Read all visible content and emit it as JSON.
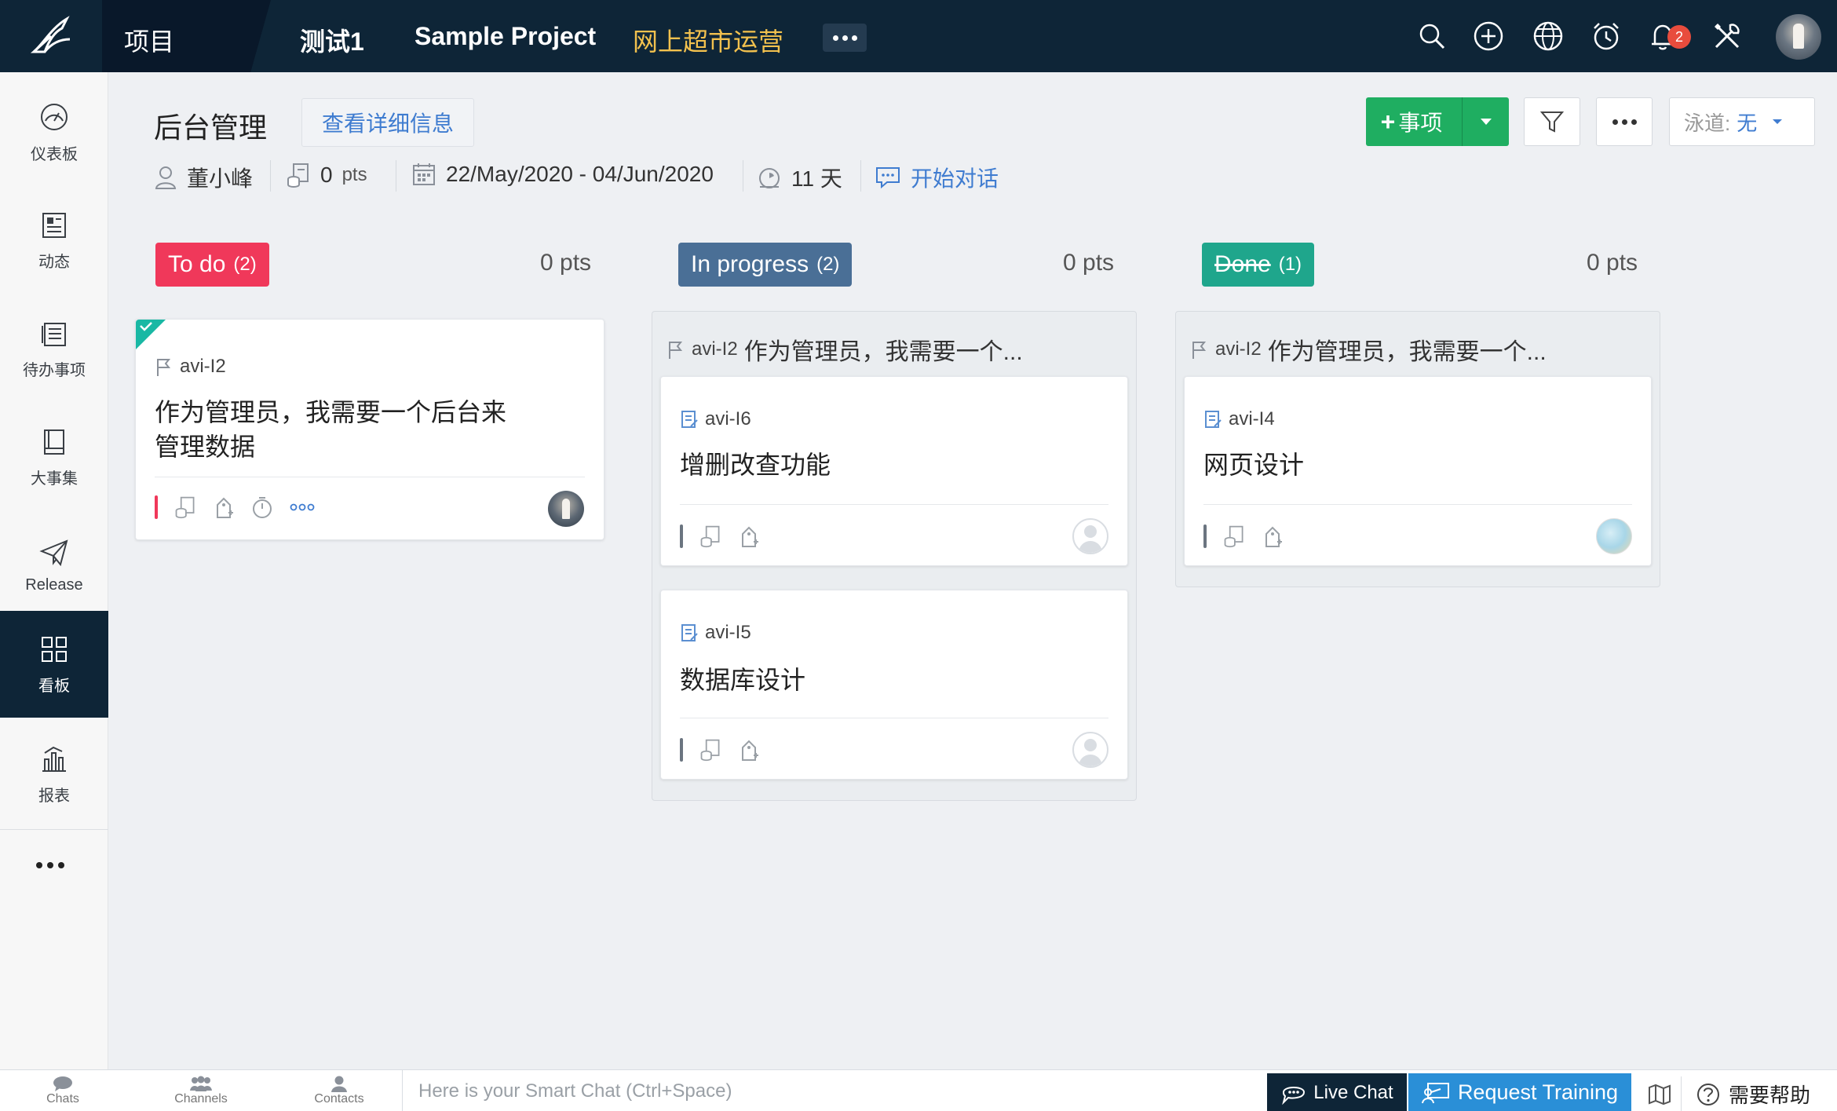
{
  "topbar": {
    "nav_label": "项目",
    "crumbs": [
      "测试1",
      "Sample Project",
      "网上超市运营"
    ],
    "notification_count": "2",
    "icons": [
      "search-icon",
      "add-circle-icon",
      "globe-icon",
      "alarm-clock-icon",
      "bell-icon",
      "tools-icon"
    ]
  },
  "sidebar": {
    "items": [
      {
        "label": "仪表板",
        "icon": "dashboard-icon"
      },
      {
        "label": "动态",
        "icon": "feed-icon"
      },
      {
        "label": "待办事项",
        "icon": "backlog-icon"
      },
      {
        "label": "大事集",
        "icon": "epic-icon"
      },
      {
        "label": "Release",
        "icon": "paper-plane-icon"
      },
      {
        "label": "看板",
        "icon": "board-icon"
      },
      {
        "label": "报表",
        "icon": "report-icon"
      }
    ],
    "active": "看板"
  },
  "header": {
    "title": "后台管理",
    "detail_button": "查看详细信息",
    "owner": "董小峰",
    "points_value": "0",
    "points_unit": "pts",
    "date_range": "22/May/2020 - 04/Jun/2020",
    "duration": "11 天",
    "chat_link": "开始对话",
    "add_button": "事项",
    "swimlane_key": "泳道:",
    "swimlane_value": "无"
  },
  "board": {
    "columns": [
      {
        "name": "To do",
        "count": "(2)",
        "points": "0 pts",
        "color": "#f0385a",
        "cards": [
          {
            "id": "avi-I2",
            "title_lines": [
              "作为管理员，我需要一个后台来",
              "管理数据"
            ],
            "priority_color": "#f0385a"
          }
        ]
      },
      {
        "name": "In progress",
        "count": "(2)",
        "points": "0 pts",
        "color": "#4a6f96",
        "parent": {
          "id": "avi-I2",
          "title": "作为管理员，我需要一个..."
        },
        "cards": [
          {
            "id": "avi-I6",
            "title": "增删改查功能",
            "priority_color": "#6b7580"
          },
          {
            "id": "avi-I5",
            "title": "数据库设计",
            "priority_color": "#6b7580"
          }
        ]
      },
      {
        "name": "Done",
        "count": "(1)",
        "points": "0 pts",
        "color": "#1fa68c",
        "parent": {
          "id": "avi-I2",
          "title": "作为管理员，我需要一个..."
        },
        "cards": [
          {
            "id": "avi-I4",
            "title": "网页设计",
            "priority_color": "#6b7580"
          }
        ]
      }
    ]
  },
  "bottombar": {
    "tabs": [
      "Chats",
      "Channels",
      "Contacts"
    ],
    "chat_placeholder": "Here is your Smart Chat (Ctrl+Space)",
    "live_chat": "Live Chat",
    "request_training": "Request Training",
    "help": "需要帮助"
  }
}
